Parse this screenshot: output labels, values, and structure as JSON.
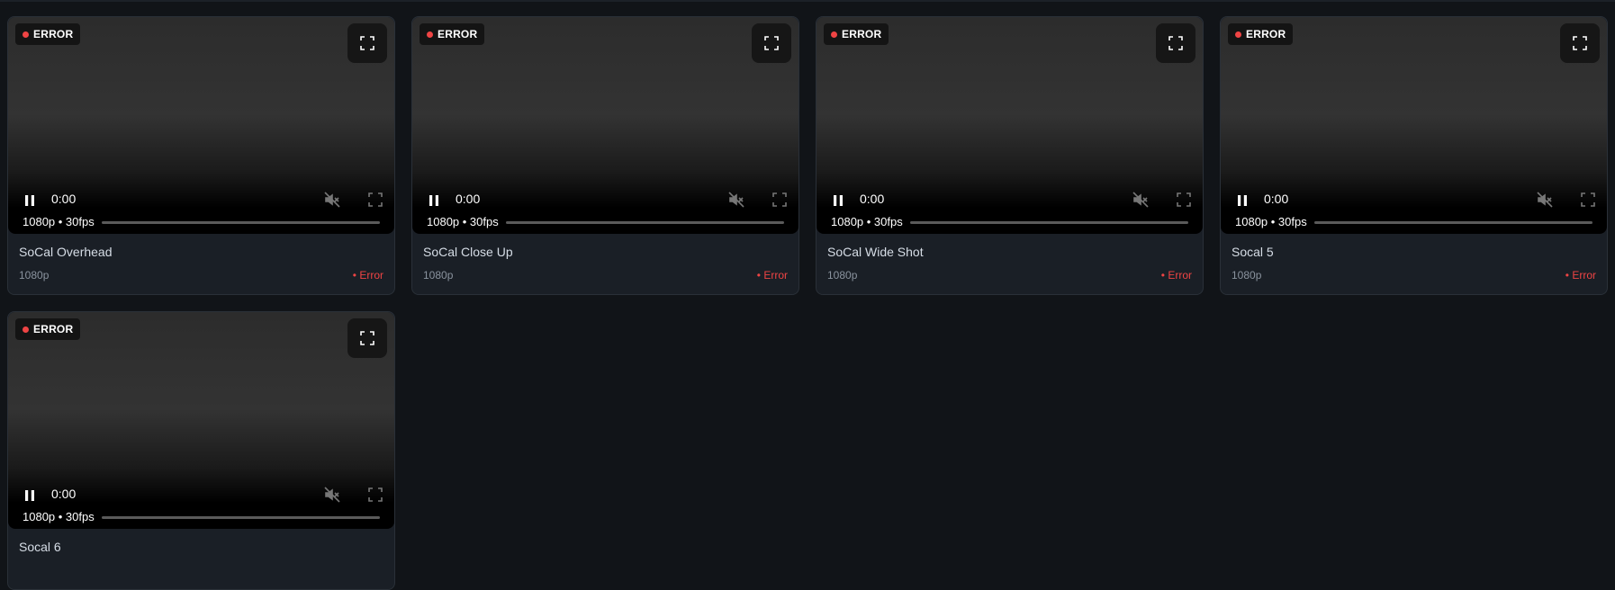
{
  "colors": {
    "background": "#111418",
    "card": "#1a1f26",
    "error": "#ef4444",
    "text": "#d6dde6",
    "muted": "#8a939e"
  },
  "icons": {
    "fullscreen": "fullscreen-icon",
    "pause": "pause-icon",
    "muted": "volume-muted-icon"
  },
  "cameras": [
    {
      "name": "SoCal Overhead",
      "resolution": "1080p",
      "status": "• Error",
      "badge": "ERROR",
      "time": "0:00",
      "stream_info": "1080p • 30fps"
    },
    {
      "name": "SoCal Close Up",
      "resolution": "1080p",
      "status": "• Error",
      "badge": "ERROR",
      "time": "0:00",
      "stream_info": "1080p • 30fps"
    },
    {
      "name": "SoCal Wide Shot",
      "resolution": "1080p",
      "status": "• Error",
      "badge": "ERROR",
      "time": "0:00",
      "stream_info": "1080p • 30fps"
    },
    {
      "name": "Socal 5",
      "resolution": "1080p",
      "status": "• Error",
      "badge": "ERROR",
      "time": "0:00",
      "stream_info": "1080p • 30fps"
    },
    {
      "name": "Socal 6",
      "resolution": "",
      "status": "",
      "badge": "ERROR",
      "time": "0:00",
      "stream_info": "1080p • 30fps"
    }
  ]
}
